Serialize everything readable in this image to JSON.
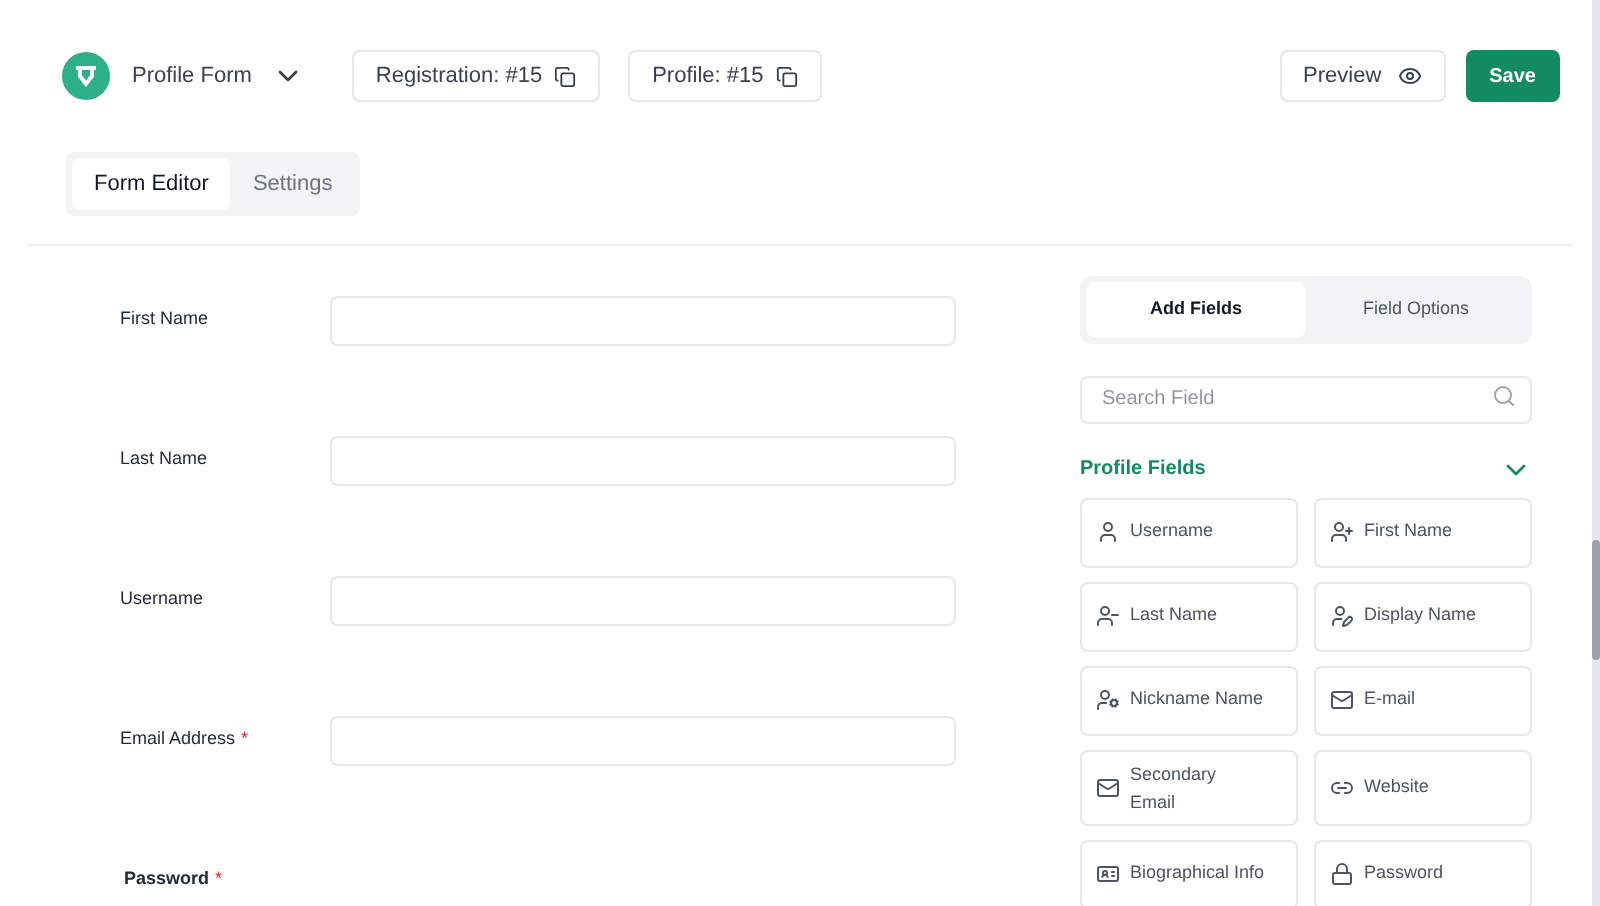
{
  "header": {
    "form_name": "Profile Form",
    "badges": [
      "Registration: #15",
      "Profile: #15"
    ],
    "preview": "Preview",
    "save": "Save"
  },
  "tabs": [
    {
      "label": "Form Editor",
      "selected": true
    },
    {
      "label": "Settings",
      "selected": false
    }
  ],
  "form_fields": [
    {
      "label": "First Name",
      "kind": "input"
    },
    {
      "label": "Last Name",
      "kind": "input"
    },
    {
      "label": "Username",
      "kind": "input"
    },
    {
      "label": "Email Address",
      "required_mark": "*",
      "kind": "input"
    },
    {
      "label": "Password",
      "required_mark": "*",
      "kind": "heading"
    }
  ],
  "panel": {
    "tabs": [
      {
        "label": "Add Fields",
        "selected": true
      },
      {
        "label": "Field Options",
        "selected": false
      }
    ],
    "search": {
      "placeholder": "Search Field"
    },
    "section": {
      "title": "Profile Fields",
      "expanded": true
    },
    "fields": [
      {
        "label": "Username",
        "kind": "user"
      },
      {
        "label": "First Name",
        "kind": "user-first"
      },
      {
        "label": "Last Name",
        "kind": "user-last"
      },
      {
        "label": "Display Name",
        "kind": "user-display"
      },
      {
        "label": "Nickname Name",
        "kind": "user-nickname"
      },
      {
        "label": "E-mail",
        "kind": "mail"
      },
      {
        "label": "Secondary Email",
        "kind": "mail"
      },
      {
        "label": "Website",
        "kind": "link"
      },
      {
        "label": "Biographical Info",
        "kind": "card"
      },
      {
        "label": "Password",
        "kind": "lock"
      }
    ]
  }
}
